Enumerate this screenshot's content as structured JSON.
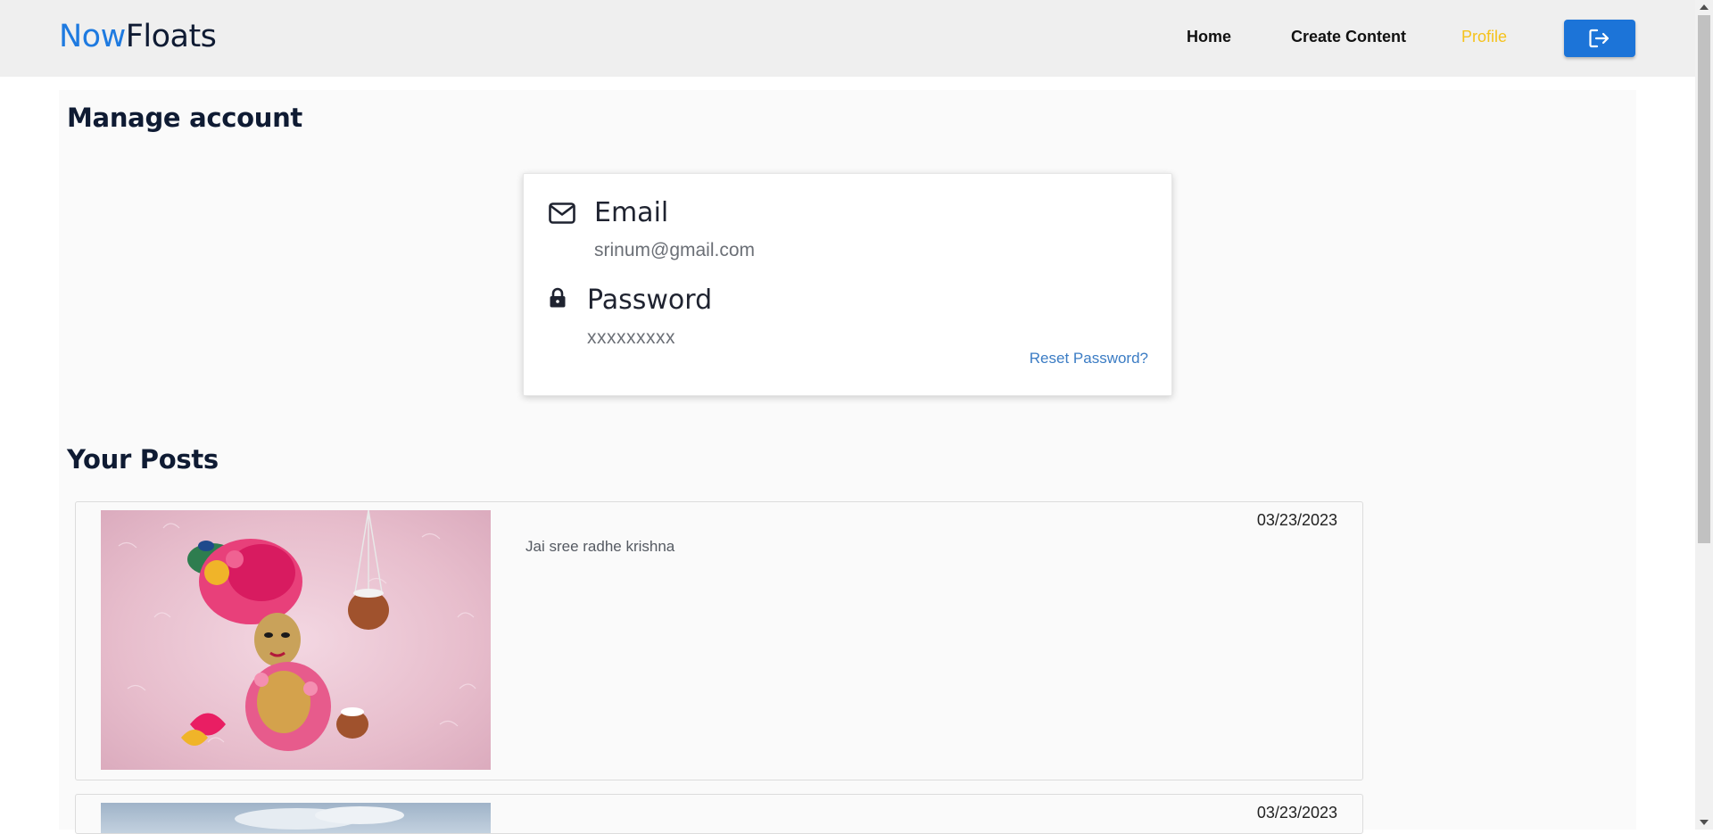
{
  "brand": {
    "part1": "Now",
    "part2": "Floats"
  },
  "nav": {
    "home": "Home",
    "create_content": "Create Content",
    "profile": "Profile",
    "logout_icon": "logout-icon"
  },
  "manage": {
    "title": "Manage account",
    "email_label": "Email",
    "email_value": "srinum@gmail.com",
    "email_icon": "envelope-icon",
    "password_label": "Password",
    "password_value": "xxxxxxxxx",
    "password_icon": "lock-icon",
    "reset_link": "Reset Password?"
  },
  "posts": {
    "title": "Your Posts",
    "items": [
      {
        "date": "03/23/2023",
        "caption": "Jai sree radhe krishna",
        "image": "krishna-idol-photo"
      },
      {
        "date": "03/23/2023",
        "caption": "",
        "image": "sky-photo"
      }
    ]
  },
  "colors": {
    "accent_blue": "#1e7ae0",
    "button_blue": "#1c74d8",
    "profile_active": "#f5c21b",
    "link": "#3b7cc4"
  }
}
